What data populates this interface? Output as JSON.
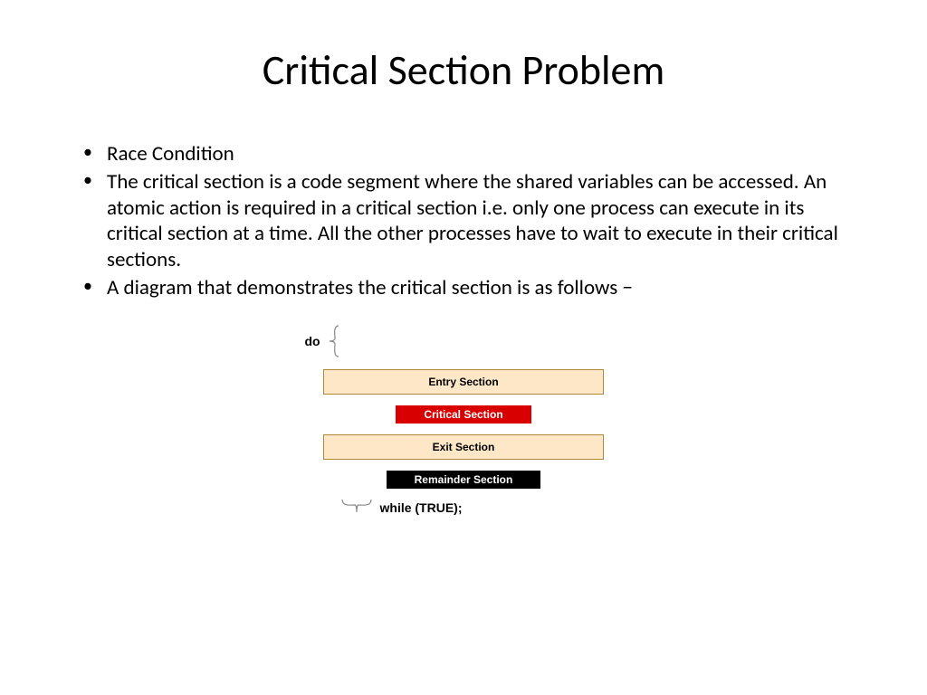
{
  "title": "Critical Section Problem",
  "bullets": {
    "b1": "Race Condition",
    "b2": "The critical section is a code segment where the shared variables can be accessed. An atomic action is required in a critical section i.e. only one process can execute in its critical section at a time. All the other processes have to wait to execute in their critical sections.",
    "b3": "A diagram that demonstrates the critical section is as follows −"
  },
  "diagram": {
    "do_label": "do",
    "entry": "Entry Section",
    "critical": "Critical Section",
    "exit": "Exit Section",
    "remainder": "Remainder Section",
    "while_label": "while (TRUE);"
  }
}
